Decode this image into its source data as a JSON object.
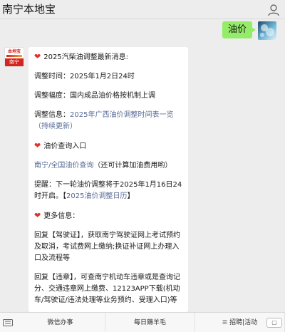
{
  "header": {
    "title": "南宁本地宝",
    "user_icon": "user-icon"
  },
  "user_message": {
    "text": "油价"
  },
  "bot_avatar": {
    "top_text": "本地宝",
    "bottom_text": "南宁"
  },
  "card": {
    "p1_text": "2025汽柴油调整最新消息:",
    "p2_text": "调整时间：2025年1月2日24时",
    "p3_text": "调整幅度：国内成品油价格按机制上调",
    "p4_prefix": "调整信息：",
    "p4_link": "2025年广西油价调整时间表一览（持续更新）",
    "p5_text": "油价查询入口",
    "p6_link": "南宁/全国油价查询",
    "p6_suffix": "（还可计算加油费用哟）",
    "p7_text": "提醒：下一轮油价调整将于2025年1月16日24时开启。【",
    "p7_link": "2025油价调整日历",
    "p7_end": "】",
    "p8_text": "更多信息：",
    "p9_text": "回复【驾驶证】，获取南宁驾驶证网上考试预约及取消，考试费网上缴纳;换证补证网上办理入口及流程等",
    "p10_text": "回复【违章】，可查南宁机动车违章或是查询记分、交通违章网上缴费、12123APP下载(机动车/驾驶证/违法处理等业务预约、受理入口)等"
  },
  "bottom_menu": {
    "items": [
      {
        "label": "微信办事"
      },
      {
        "label": "每日薅羊毛"
      },
      {
        "label": "招聘|活动"
      }
    ]
  },
  "colors": {
    "green_bubble": "#95ec69",
    "link": "#576b95",
    "heart": "#e0312c"
  }
}
